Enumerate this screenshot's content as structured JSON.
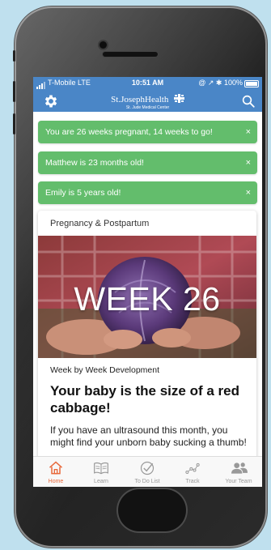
{
  "status_bar": {
    "carrier": "T-Mobile  LTE",
    "time": "10:51 AM",
    "indicators": "@ ↗ ✱ 100%"
  },
  "header": {
    "logo_text": "St.JosephHealth",
    "logo_subtext": "St. Jude Medical Center",
    "left_icon": "gear-icon",
    "right_icon": "search-icon",
    "color": "#4a86c7"
  },
  "notifications": [
    {
      "text": "You are 26 weeks pregnant, 14 weeks to go!",
      "close": "×"
    },
    {
      "text": "Matthew  is 23 months old!",
      "close": "×"
    },
    {
      "text": "Emily is 5 years old!",
      "close": "×"
    }
  ],
  "notification_color": "#63bd6c",
  "card": {
    "category": "Pregnancy & Postpartum",
    "week_label": "WEEK 26",
    "subtitle": "Week by Week Development",
    "title": "Your baby is the size of a red cabbage!",
    "body": "If you have an ultrasound this month, you might find your unborn baby sucking a thumb!"
  },
  "tabs": [
    {
      "label": "Home",
      "icon": "home-icon",
      "active": true
    },
    {
      "label": "Learn",
      "icon": "book-icon",
      "active": false
    },
    {
      "label": "To Do List",
      "icon": "checkmark-icon",
      "active": false
    },
    {
      "label": "Track",
      "icon": "chart-icon",
      "active": false
    },
    {
      "label": "Your Team",
      "icon": "people-icon",
      "active": false
    }
  ],
  "accent_color": "#e8683a"
}
